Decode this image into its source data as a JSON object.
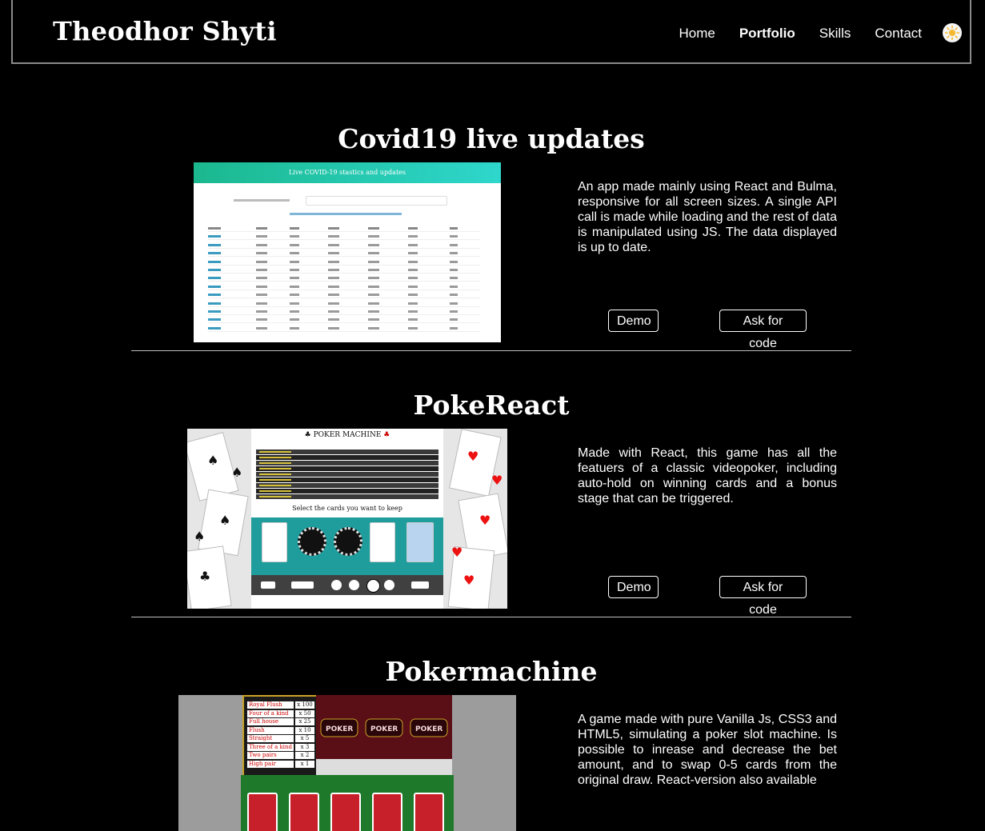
{
  "header": {
    "brand": "Theodhor Shyti",
    "nav": [
      "Home",
      "Portfolio",
      "Skills",
      "Contact"
    ],
    "active": "Portfolio",
    "theme_icon": "sun-icon"
  },
  "projects": [
    {
      "title": "Covid19 live updates",
      "description": "An app made mainly using React and Bulma, responsive for all screen sizes. A single API call is made while loading and the rest of data is manipulated using JS. The data displayed is up to date.",
      "demo_label": "Demo",
      "code_label": "Ask for code",
      "screenshot_header": "Live COVID-19 stastics and updates"
    },
    {
      "title": "PokeReact",
      "description": "Made with React, this game has all the featuers of a classic videopoker, including auto-hold on winning cards and a bonus stage that can be triggered.",
      "demo_label": "Demo",
      "code_label": "Ask for code",
      "screenshot_header": "POKER MACHINE",
      "screenshot_prompt": "Select the cards you want to keep"
    },
    {
      "title": "Pokermachine",
      "description": "A game made with pure Vanilla Js, CSS3 and HTML5, simulating a poker slot machine. Is possible to inrease and decrease the bet amount, and to swap 0-5 cards from the original draw. React-version also available",
      "paytable": [
        {
          "hand": "Royal Flush",
          "mult": "x 100"
        },
        {
          "hand": "Four of a kind",
          "mult": "x 50"
        },
        {
          "hand": "Full house",
          "mult": "x 25"
        },
        {
          "hand": "Flush",
          "mult": "x 10"
        },
        {
          "hand": "Straight",
          "mult": "x 5"
        },
        {
          "hand": "Three of a kind",
          "mult": "x 3"
        },
        {
          "hand": "Two pairs",
          "mult": "x 2"
        },
        {
          "hand": "High pair",
          "mult": "x 1"
        }
      ]
    }
  ],
  "colors": {
    "background": "#000000",
    "text": "#ffffff",
    "header_border": "#8a8a8a",
    "covid_gradient_start": "#1bb88f",
    "covid_gradient_end": "#2ed7cc"
  }
}
